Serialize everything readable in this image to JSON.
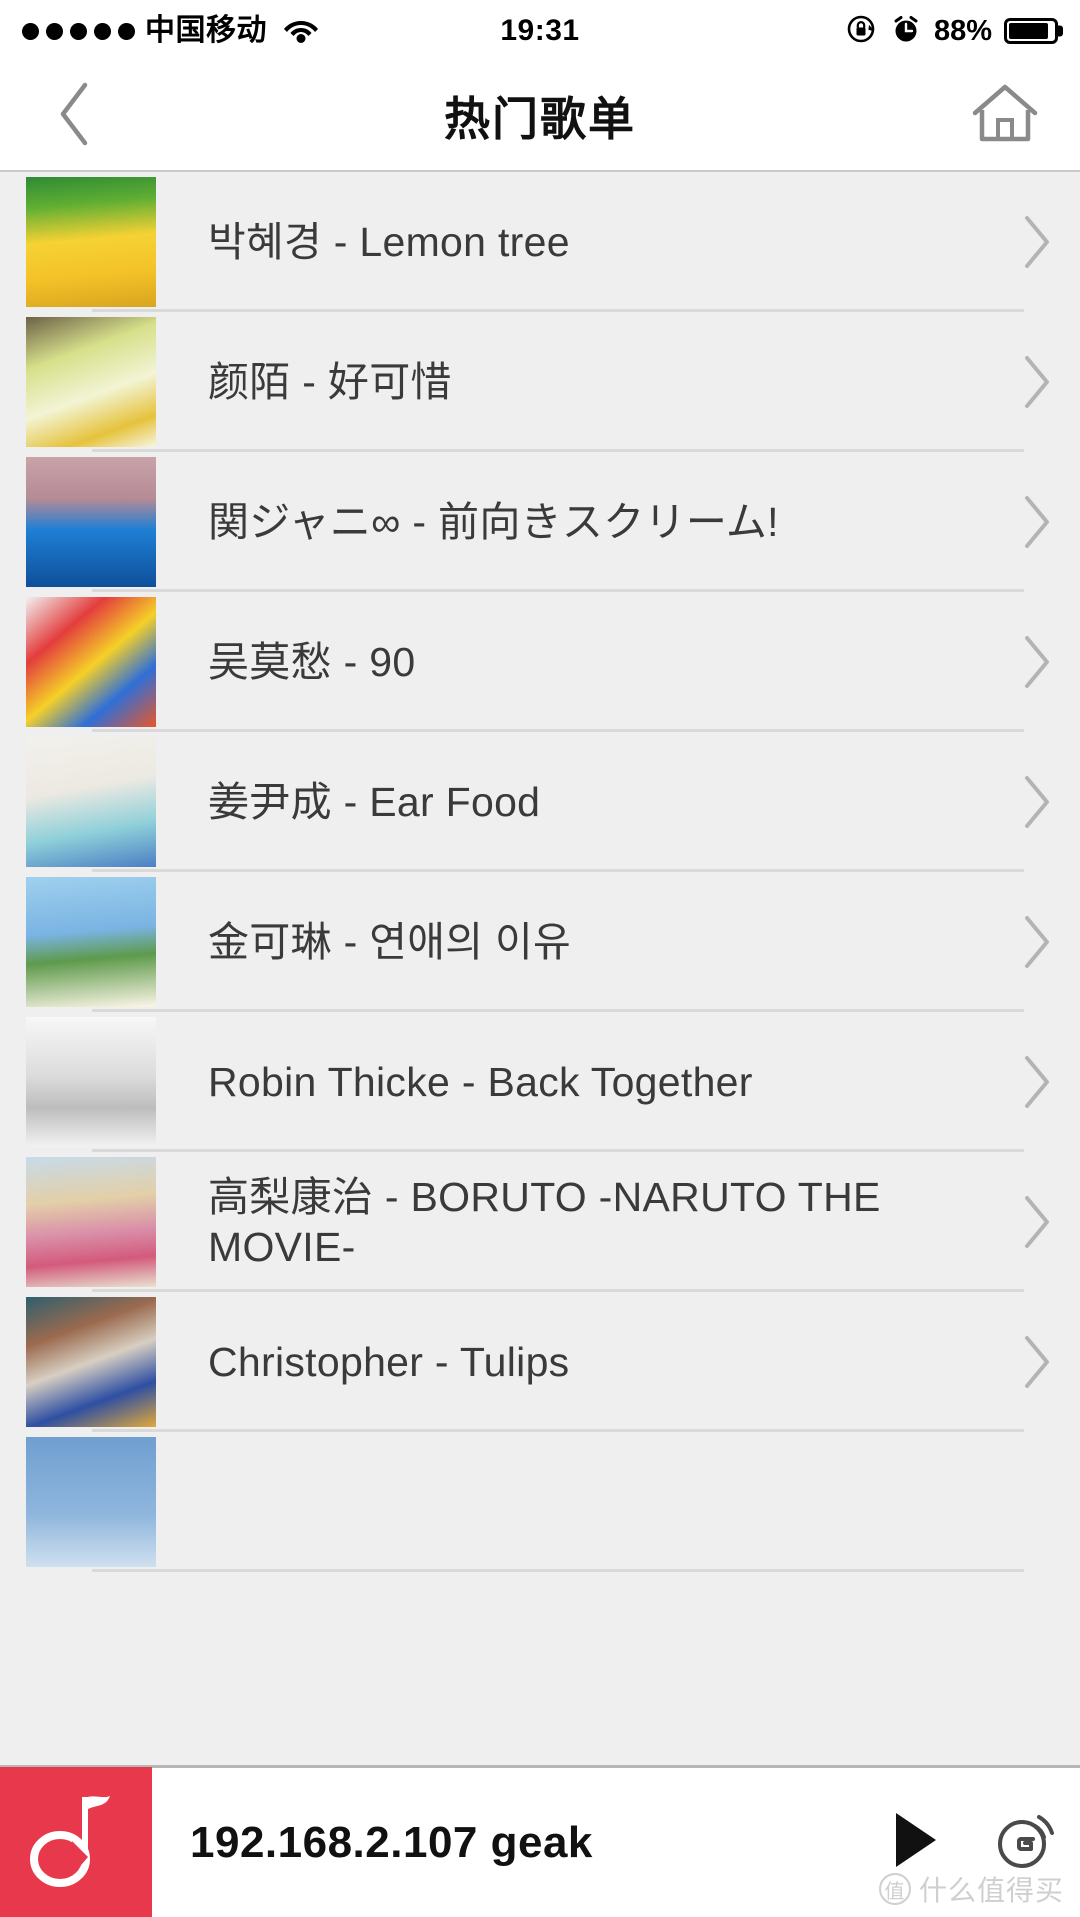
{
  "status_bar": {
    "signal_dots": 5,
    "carrier": "中国移动",
    "wifi_icon": "wifi-icon",
    "time": "19:31",
    "rotation_lock_icon": "rotation-lock-icon",
    "alarm_icon": "alarm-clock-icon",
    "battery_percent": "88%",
    "battery_level": 88
  },
  "navbar": {
    "back_icon": "chevron-left-icon",
    "title": "热门歌单",
    "home_icon": "home-icon"
  },
  "list": {
    "items": [
      {
        "label": "박혜경 - Lemon tree",
        "chevron": "chevron-right-icon",
        "art": "art-lemon-tree"
      },
      {
        "label": "颜陌 - 好可惜",
        "chevron": "chevron-right-icon",
        "art": "art-leaves"
      },
      {
        "label": "関ジャニ∞ - 前向きスクリーム!",
        "chevron": "chevron-right-icon",
        "art": "art-kanjani"
      },
      {
        "label": "吴莫愁 - 90",
        "chevron": "chevron-right-icon",
        "art": "art-90"
      },
      {
        "label": "姜尹成 - Ear Food",
        "chevron": "chevron-right-icon",
        "art": "art-ear-food"
      },
      {
        "label": "金可琳 - 연애의 이유",
        "chevron": "chevron-right-icon",
        "art": "art-tower"
      },
      {
        "label": "Robin Thicke - Back Together",
        "chevron": "chevron-right-icon",
        "art": "art-robin-thicke"
      },
      {
        "label": "高梨康治 - BORUTO -NARUTO THE MOVIE-",
        "chevron": "chevron-right-icon",
        "art": "art-boruto"
      },
      {
        "label": "Christopher - Tulips",
        "chevron": "chevron-right-icon",
        "art": "art-christopher"
      }
    ]
  },
  "player": {
    "art_icon": "music-note-icon",
    "title": "192.168.2.107 geak",
    "play_icon": "play-icon",
    "cast_icon": "geak-cast-icon",
    "cast_letter": "G"
  },
  "watermark": {
    "badge": "值",
    "text": "什么值得买"
  },
  "colors": {
    "accent_red": "#e8394c",
    "list_bg": "#efefef",
    "text": "#3a3a3a",
    "divider": "#d9d9d9"
  }
}
